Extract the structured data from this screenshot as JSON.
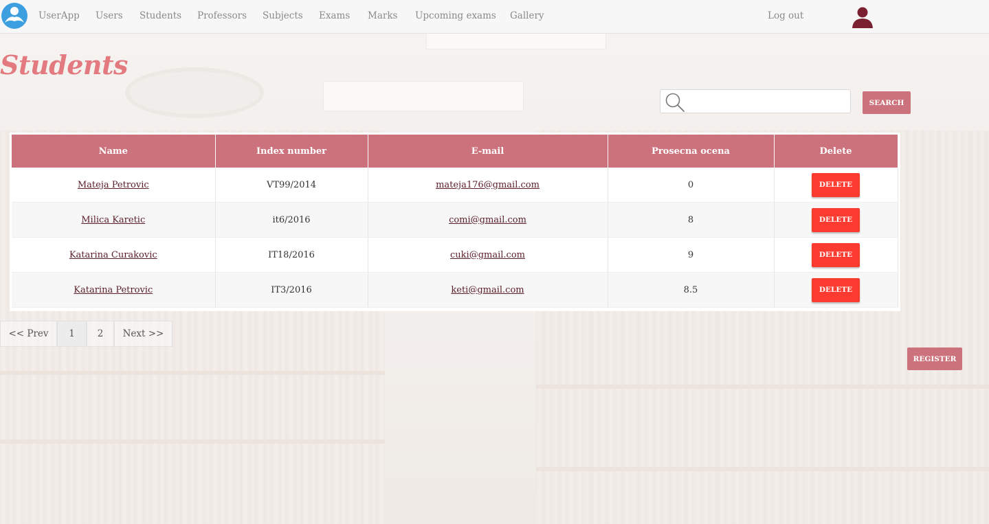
{
  "navbar": {
    "brand": "UserApp",
    "items": [
      {
        "label": "Users"
      },
      {
        "label": "Students"
      },
      {
        "label": "Professors"
      },
      {
        "label": "Subjects"
      },
      {
        "label": "Exams"
      },
      {
        "label": "Marks"
      },
      {
        "label": "Upcoming exams"
      },
      {
        "label": "Gallery"
      }
    ],
    "logout": "Log out",
    "logo_icon": "userapp-logo-icon",
    "avatar_icon": "user-avatar-icon"
  },
  "page": {
    "title": "Students"
  },
  "search": {
    "value": "",
    "placeholder": "",
    "button_label": "SEARCH",
    "icon": "search-icon"
  },
  "table": {
    "columns": [
      "Name",
      "Index number",
      "E-mail",
      "Prosecna ocena",
      "Delete"
    ],
    "rows": [
      {
        "name": "Mateja Petrovic",
        "index": "VT99/2014",
        "email": "mateja176@gmail.com",
        "grade": "0",
        "delete_label": "DELETE"
      },
      {
        "name": "Milica Karetic",
        "index": "it6/2016",
        "email": "comi@gmail.com",
        "grade": "8",
        "delete_label": "DELETE"
      },
      {
        "name": "Katarina Curakovic",
        "index": "IT18/2016",
        "email": "cuki@gmail.com",
        "grade": "9",
        "delete_label": "DELETE"
      },
      {
        "name": "Katarina Petrovic",
        "index": "IT3/2016",
        "email": "keti@gmail.com",
        "grade": "8.5",
        "delete_label": "DELETE"
      }
    ]
  },
  "pagination": {
    "prev": "<< Prev",
    "pages": [
      "1",
      "2"
    ],
    "current_page": "1",
    "next": "Next >>"
  },
  "register_button": "REGISTER",
  "colors": {
    "accent": "#cc727c",
    "title": "#e37a80",
    "delete": "#fb3b30",
    "link": "#5a1e28",
    "avatar": "#7a2131",
    "logo": "#3d9fe0"
  }
}
